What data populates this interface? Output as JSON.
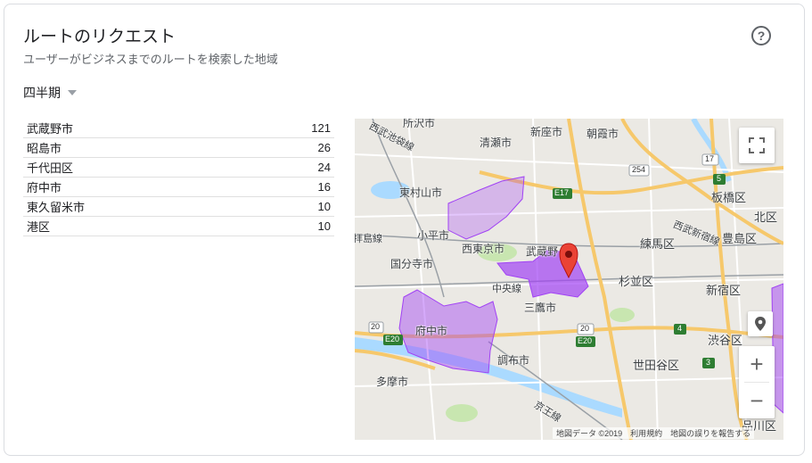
{
  "card": {
    "title": "ルートのリクエスト",
    "subtitle": "ユーザーがビジネスまでのルートを検索した地域",
    "help_icon": "?",
    "period_label": "四半期"
  },
  "table": {
    "rows": [
      {
        "name": "武蔵野市",
        "value": "121"
      },
      {
        "name": "昭島市",
        "value": "26"
      },
      {
        "name": "千代田区",
        "value": "24"
      },
      {
        "name": "府中市",
        "value": "16"
      },
      {
        "name": "東久留米市",
        "value": "10"
      },
      {
        "name": "港区",
        "value": "10"
      }
    ]
  },
  "map": {
    "labels": {
      "tokorozawa": "所沢市",
      "seibu_ikebukuro": "西武池袋線",
      "kiyose": "清瀬市",
      "niiza": "新座市",
      "asaka": "朝霞市",
      "higashimurayama": "東村山市",
      "itabashi": "板橋区",
      "kita": "北区",
      "haijima": "拝島線",
      "kodaira": "小平市",
      "nishitokyo": "西東京市",
      "musashino": "武蔵野",
      "nerima": "練馬区",
      "seibu_shinjuku": "西武新宿線",
      "toshima": "豊島区",
      "kokubunji": "国分寺市",
      "chuo_line": "中央線",
      "suginami": "杉並区",
      "shinjuku": "新宿区",
      "mitaka": "三鷹市",
      "fuchu": "府中市",
      "shibuya": "渋谷区",
      "chofu": "調布市",
      "setagaya": "世田谷区",
      "tama": "多摩市",
      "keio": "京王線",
      "shinagawa": "品川区"
    },
    "shields": {
      "r254": "254",
      "r17": "17",
      "e17": "E17",
      "r5": "5",
      "r20a": "20",
      "e20": "E20",
      "r20b": "20",
      "e20b": "E20",
      "r4": "4",
      "r3": "3"
    },
    "attribution": "地図データ ©2019　利用規約　地図の誤りを報告する",
    "zoom_in": "+",
    "zoom_out": "−",
    "colors": {
      "region_fill": "#a142f4",
      "marker": "#ea4335",
      "road_major": "#f6c86b",
      "water": "#aadaff",
      "park": "#c8e6b0"
    }
  }
}
